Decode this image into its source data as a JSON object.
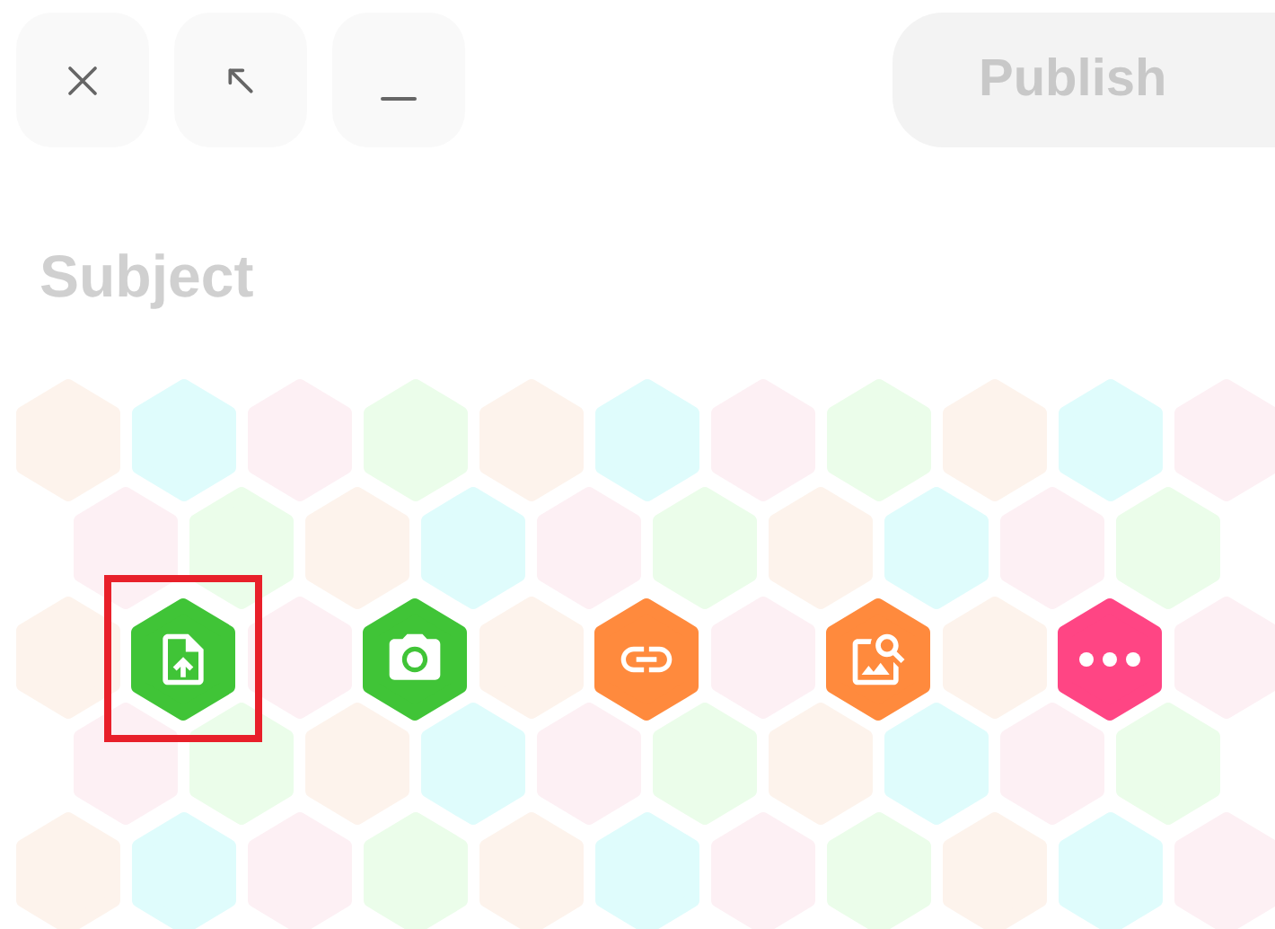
{
  "toolbar": {
    "buttons": [
      {
        "kind": "close"
      },
      {
        "kind": "expand"
      },
      {
        "kind": "minimize"
      }
    ],
    "publish": {
      "label": "Publish",
      "disabled": true
    }
  },
  "subject": {
    "placeholder": "Subject"
  },
  "actions": [
    {
      "kind": "upload",
      "color": "#40c437",
      "selected": true
    },
    {
      "kind": "camera",
      "color": "#40c437",
      "selected": false
    },
    {
      "kind": "link",
      "color": "#ff8a3d",
      "selected": false
    },
    {
      "kind": "image-search",
      "color": "#ff8a3d",
      "selected": false
    },
    {
      "kind": "more",
      "color": "#ff4584",
      "selected": false
    }
  ]
}
